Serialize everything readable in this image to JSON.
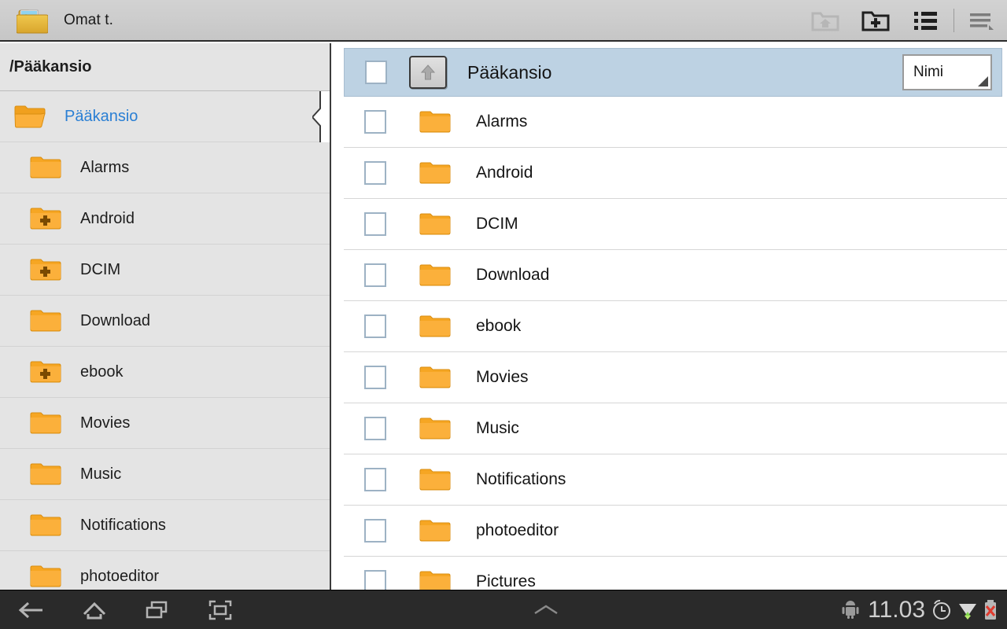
{
  "titlebar": {
    "app_icon": "folder-picture-icon",
    "app_title": "Omat t.",
    "actions": [
      {
        "name": "home-folder-icon",
        "label": "Home folder",
        "disabled": true
      },
      {
        "name": "new-folder-icon",
        "label": "New folder",
        "disabled": false
      },
      {
        "name": "list-view-icon",
        "label": "List view",
        "disabled": false
      },
      {
        "name": "menu-icon",
        "label": "Menu",
        "disabled": false
      }
    ]
  },
  "sidebar": {
    "header": "/Pääkansio",
    "items": [
      {
        "label": "Pääkansio",
        "icon": "open-folder-icon",
        "level": 0,
        "selected": true,
        "expandable": false
      },
      {
        "label": "Alarms",
        "icon": "folder-icon",
        "level": 1,
        "selected": false,
        "expandable": false
      },
      {
        "label": "Android",
        "icon": "folder-plus-icon",
        "level": 1,
        "selected": false,
        "expandable": true
      },
      {
        "label": "DCIM",
        "icon": "folder-plus-icon",
        "level": 1,
        "selected": false,
        "expandable": true
      },
      {
        "label": "Download",
        "icon": "folder-icon",
        "level": 1,
        "selected": false,
        "expandable": false
      },
      {
        "label": "ebook",
        "icon": "folder-plus-icon",
        "level": 1,
        "selected": false,
        "expandable": true
      },
      {
        "label": "Movies",
        "icon": "folder-icon",
        "level": 1,
        "selected": false,
        "expandable": false
      },
      {
        "label": "Music",
        "icon": "folder-icon",
        "level": 1,
        "selected": false,
        "expandable": false
      },
      {
        "label": "Notifications",
        "icon": "folder-icon",
        "level": 1,
        "selected": false,
        "expandable": false
      },
      {
        "label": "photoeditor",
        "icon": "folder-icon",
        "level": 1,
        "selected": false,
        "expandable": false
      }
    ]
  },
  "main": {
    "header": {
      "checkbox_checked": false,
      "up_button": "up-arrow-icon",
      "title": "Pääkansio",
      "sort_selected": "Nimi"
    },
    "rows": [
      {
        "label": "Alarms",
        "icon": "folder-icon",
        "checked": false
      },
      {
        "label": "Android",
        "icon": "folder-icon",
        "checked": false
      },
      {
        "label": "DCIM",
        "icon": "folder-icon",
        "checked": false
      },
      {
        "label": "Download",
        "icon": "folder-icon",
        "checked": false
      },
      {
        "label": "ebook",
        "icon": "folder-icon",
        "checked": false
      },
      {
        "label": "Movies",
        "icon": "folder-icon",
        "checked": false
      },
      {
        "label": "Music",
        "icon": "folder-icon",
        "checked": false
      },
      {
        "label": "Notifications",
        "icon": "folder-icon",
        "checked": false
      },
      {
        "label": "photoeditor",
        "icon": "folder-icon",
        "checked": false
      },
      {
        "label": "Pictures",
        "icon": "folder-icon",
        "checked": false
      }
    ]
  },
  "systembar": {
    "nav": [
      {
        "name": "back-icon",
        "label": "Back"
      },
      {
        "name": "home-icon",
        "label": "Home"
      },
      {
        "name": "recents-icon",
        "label": "Recent apps"
      },
      {
        "name": "screenshot-icon",
        "label": "Screenshot"
      }
    ],
    "drawer_handle": "chevron-up-icon",
    "tray": {
      "android_icon": "android-robot-icon",
      "clock": "11.03",
      "alarm_icon": "alarm-clock-icon",
      "wifi_icon": "wifi-signal-icon",
      "battery_icon": "battery-error-icon"
    }
  },
  "colors": {
    "accent_blue": "#2a7fd4",
    "header_blue": "#bdd2e3",
    "folder_orange": "#f9a825",
    "sidebar_bg": "#e4e4e4",
    "titlebar_bg": "#cdcdcd",
    "sysbar_bg": "#2a2a2a"
  }
}
